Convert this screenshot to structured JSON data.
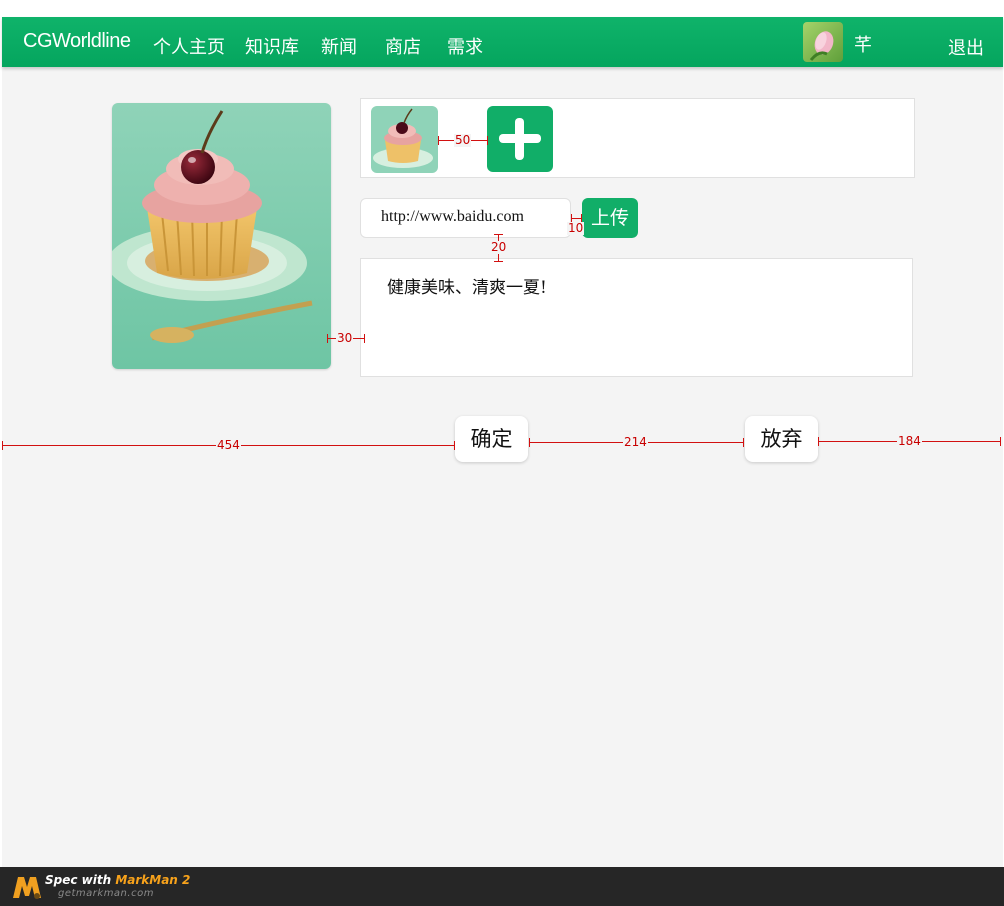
{
  "nav": {
    "brand": "CGWorldline",
    "links": [
      "个人主页",
      "知识库",
      "新闻",
      "商店",
      "需求"
    ],
    "user_name": "芊",
    "logout": "退出"
  },
  "editor": {
    "url_value": "http://www.baidu.com",
    "upload_label": "上传",
    "description": "健康美味、清爽一夏!",
    "confirm_label": "确定",
    "cancel_label": "放弃"
  },
  "measurements": {
    "thumb_gap": "50",
    "url_upload_gap": "10",
    "url_desc_gap": "20",
    "image_desc_gap": "30",
    "left_margin": "454",
    "button_gap": "214",
    "right_margin": "184"
  },
  "footer": {
    "spec": "Spec with",
    "brand": "MarkMan 2",
    "site": "getmarkman.com"
  },
  "colors": {
    "primary_green": "#11ae68",
    "measure_red": "#d21010",
    "background": "#f4f4f4"
  }
}
